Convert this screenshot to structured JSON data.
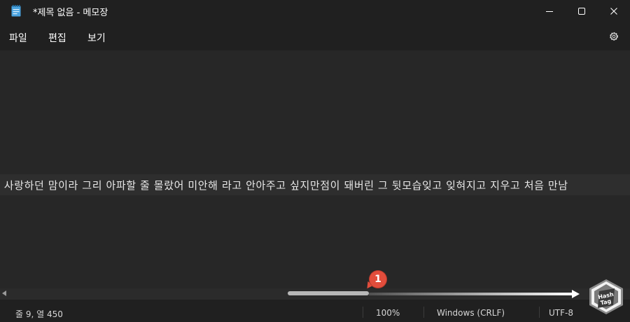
{
  "window": {
    "title": "*제목 없음 - 메모장",
    "app_icon": "notepad-icon",
    "controls": [
      "minimize-icon",
      "maximize-icon",
      "close-icon"
    ]
  },
  "menu": {
    "items": [
      {
        "label": "파일"
      },
      {
        "label": "편집"
      },
      {
        "label": "보기"
      }
    ],
    "settings_icon": "gear-icon"
  },
  "editor": {
    "visible_text": "라 사랑하던 맘이라 그리 아파할 줄 몰랐어 미안해 라고 안아주고 싶지만점이 돼버린 그 뒷모습잊고 잊혀지고 지우고 처음 만남"
  },
  "annotation": {
    "number": "1"
  },
  "scrollbar": {
    "position_fraction": 0.52
  },
  "status": {
    "position": "줄 9, 열 450",
    "zoom": "100%",
    "line_ending": "Windows (CRLF)",
    "encoding": "UTF-8"
  },
  "watermark": {
    "lines": [
      "Hash",
      "Tag"
    ]
  },
  "colors": {
    "titlebar": "#202020",
    "editor_bg": "#272727",
    "badge": "#e24d3c",
    "notepad_blue": "#4aa3df"
  }
}
